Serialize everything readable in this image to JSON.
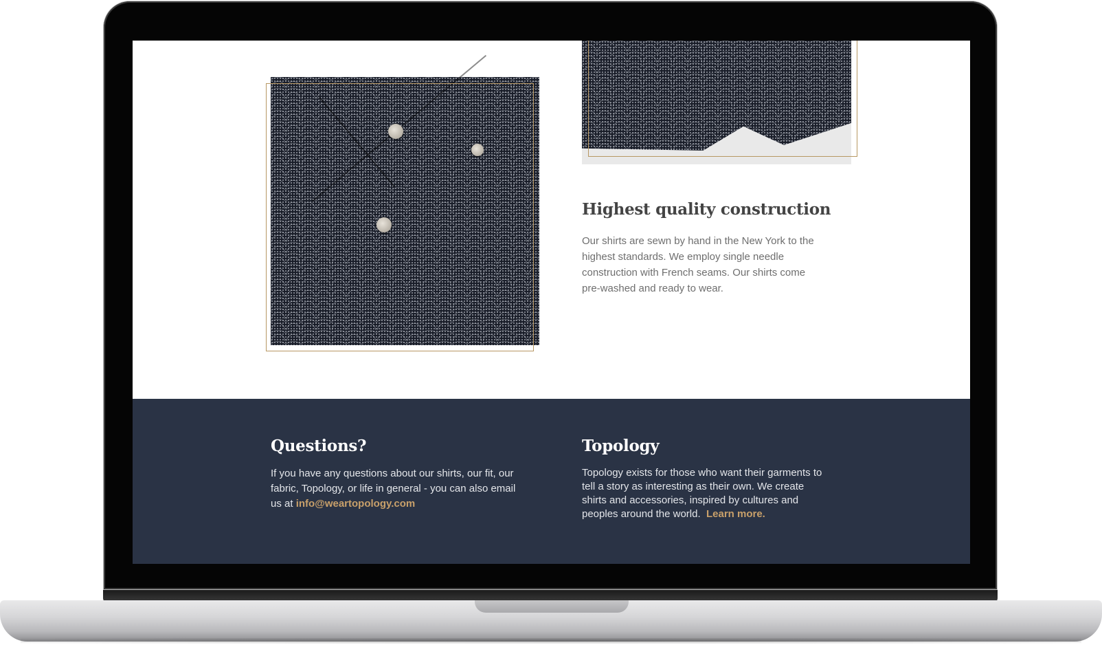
{
  "colors": {
    "accent": "#b79762",
    "footer_bg": "#2a3345",
    "heading": "#444444",
    "body_text": "#6e6e6e"
  },
  "feature": {
    "title": "Highest quality construction",
    "body": "Our shirts are sewn by hand in the New York to the highest standards. We employ single needle construction with French seams. Our shirts come pre-washed and ready to wear."
  },
  "footer": {
    "questions": {
      "title": "Questions?",
      "body": "If you have any questions about our shirts, our fit, our fabric, Topology, or life in general - you can also email us at",
      "email": "info@weartopology.com"
    },
    "about": {
      "title": "Topology",
      "body": "Topology exists for those who want their garments to tell a story as interesting as their own. We create shirts and accessories, inspired by cultures and peoples around the world.",
      "link": "Learn more."
    }
  }
}
